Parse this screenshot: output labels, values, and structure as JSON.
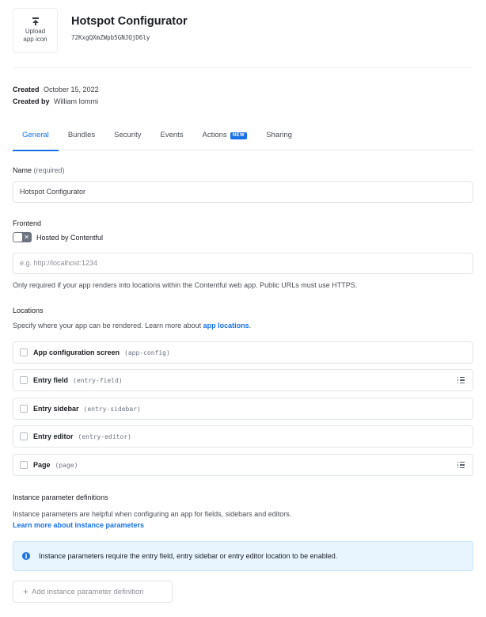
{
  "header": {
    "upload_label_line1": "Upload",
    "upload_label_line2": "app icon",
    "upload_icon": "upload-icon",
    "app_title": "Hotspot Configurator",
    "app_id": "72KxgQXmZWpb5GNJQjD6ly"
  },
  "meta": {
    "created_label": "Created",
    "created_value": "October 15, 2022",
    "created_by_label": "Created by",
    "created_by_value": "William Iommi"
  },
  "tabs": [
    {
      "label": "General",
      "active": true
    },
    {
      "label": "Bundles",
      "active": false
    },
    {
      "label": "Security",
      "active": false
    },
    {
      "label": "Events",
      "active": false
    },
    {
      "label": "Actions",
      "active": false,
      "badge": "NEW"
    },
    {
      "label": "Sharing",
      "active": false
    }
  ],
  "name_field": {
    "label": "Name",
    "hint": "(required)",
    "value": "Hotspot Configurator"
  },
  "frontend": {
    "label": "Frontend",
    "toggle_label": "Hosted by Contentful",
    "toggle_on": false,
    "toggle_icon": "x-icon",
    "url_placeholder": "e.g. http://localhost:1234",
    "url_value": "",
    "help": "Only required if your app renders into locations within the Contentful web app. Public URLs must use HTTPS."
  },
  "locations": {
    "label": "Locations",
    "help_prefix": "Specify where your app can be rendered. Learn more about ",
    "help_link": "app locations",
    "help_suffix": ".",
    "items": [
      {
        "name": "App configuration screen",
        "code": "(app-config)",
        "checked": false,
        "has_list_icon": false
      },
      {
        "name": "Entry field",
        "code": "(entry-field)",
        "checked": false,
        "has_list_icon": true
      },
      {
        "name": "Entry sidebar",
        "code": "(entry-sidebar)",
        "checked": false,
        "has_list_icon": false
      },
      {
        "name": "Entry editor",
        "code": "(entry-editor)",
        "checked": false,
        "has_list_icon": false
      },
      {
        "name": "Page",
        "code": "(page)",
        "checked": false,
        "has_list_icon": true
      }
    ]
  },
  "instance_params": {
    "label": "Instance parameter definitions",
    "help": "Instance parameters are helpful when configuring an app for fields, sidebars and editors.",
    "link": "Learn more about instance parameters",
    "info_icon": "i",
    "info_text": "Instance parameters require the entry field, entry sidebar or entry editor location to be enabled.",
    "add_button_plus": "+",
    "add_button_label": "Add instance parameter definition"
  },
  "colors": {
    "accent": "#1872e5",
    "info_bg": "#e8f5ff",
    "toggle_off": "#6c7280"
  }
}
